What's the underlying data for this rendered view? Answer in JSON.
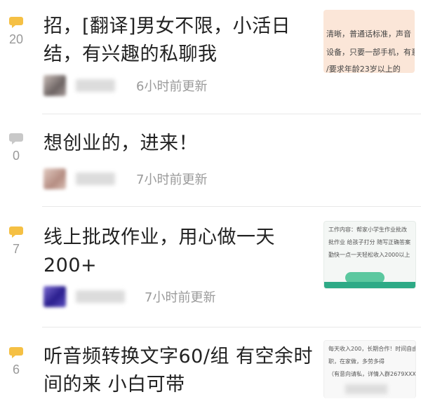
{
  "posts": [
    {
      "reply_count": "20",
      "title": "招，[翻译]男女不限，小活日结，有兴趣的私聊我",
      "time": "6小时前更新",
      "thumb_lines": [
        "清晰，普通话标准，声音",
        "设备，只要一部手机，有意",
        "/要求年龄23岁以上的"
      ]
    },
    {
      "reply_count": "0",
      "title": "想创业的，进来！",
      "time": "7小时前更新",
      "thumb_lines": []
    },
    {
      "reply_count": "7",
      "title": "线上批改作业，用心做一天200+",
      "time": "7小时前更新",
      "thumb_lines": [
        "工作内容：帮家小学生作业批改",
        "批作业  给孩子打分  随写正确答案",
        "勤快一点一天轻松收入2000以上"
      ]
    },
    {
      "reply_count": "6",
      "title": "听音频转换文字60/组 有空余时间的来 小白可带",
      "time": "",
      "thumb_lines": [
        "每天收入200，长期合作！时间自由，兼",
        "职，在家做，多劳多得",
        "（有意向请私，详情入群2679XXXX）"
      ]
    }
  ],
  "colors": {
    "bubble_active": "#f5c044",
    "bubble_inactive": "#c8c8c8"
  }
}
